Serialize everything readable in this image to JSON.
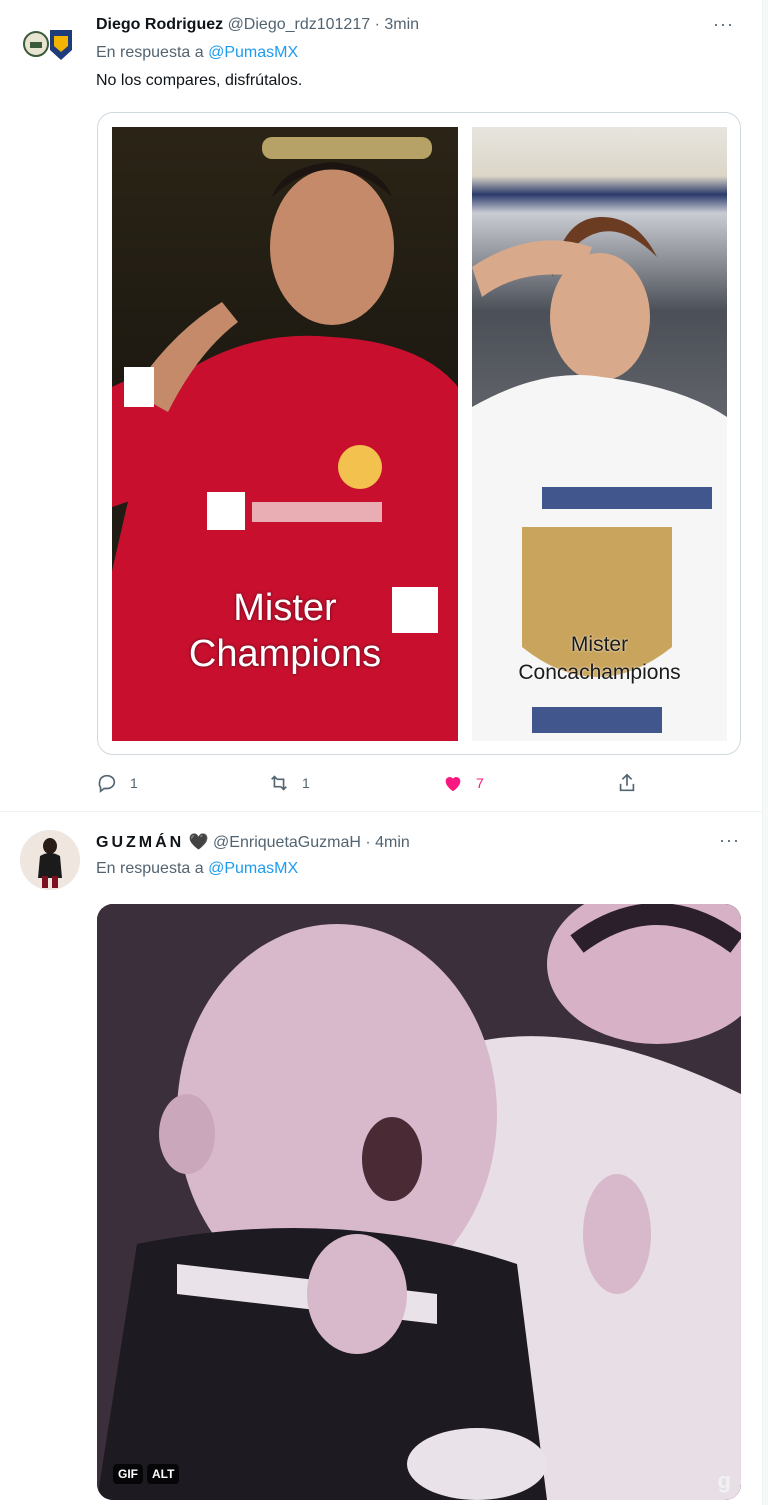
{
  "tweets": [
    {
      "display_name": "Diego Rodriguez",
      "handle": "@Diego_rdz101217",
      "separator": "·",
      "time": "3min",
      "reply_prefix": "En respuesta a",
      "reply_to": "@PumasMX",
      "text": "No los compares, disfrútalos.",
      "media": {
        "left_caption_line1": "Mister",
        "left_caption_line2": "Champions",
        "right_caption_line1": "Mister",
        "right_caption_line2": "Concachampions"
      },
      "actions": {
        "reply_count": "1",
        "retweet_count": "1",
        "like_count": "7"
      },
      "more_label": "···"
    },
    {
      "display_name": "GUZMÁN",
      "heart_glyph": "🖤",
      "handle": "@EnriquetaGuzmaH",
      "separator": "·",
      "time": "4min",
      "reply_prefix": "En respuesta a",
      "reply_to": "@PumasMX",
      "media": {
        "gif_badge": "GIF",
        "alt_badge": "ALT",
        "watermark": "g"
      },
      "more_label": "···"
    }
  ],
  "colors": {
    "like_pink": "#f91880",
    "mention_blue": "#1d9bf0",
    "muted_gray": "#536471"
  },
  "icons": [
    "reply-icon",
    "retweet-icon",
    "like-icon",
    "share-icon",
    "more-icon"
  ]
}
